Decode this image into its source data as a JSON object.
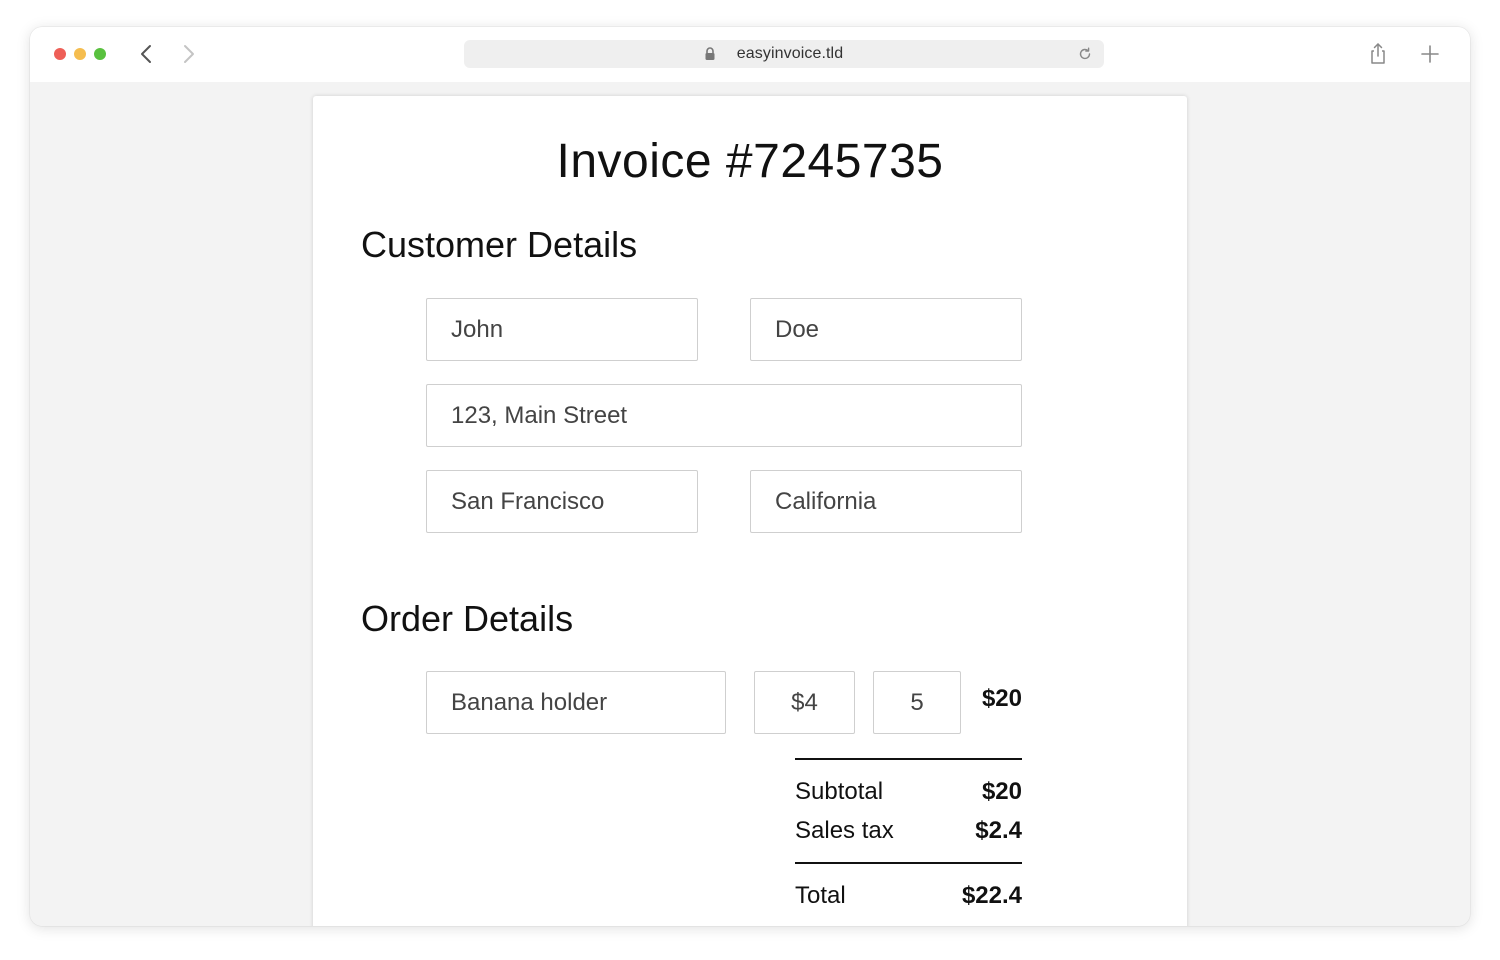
{
  "browser": {
    "url": "easyinvoice.tld"
  },
  "invoice": {
    "title": "Invoice #7245735"
  },
  "customer": {
    "heading": "Customer Details",
    "first_name": "John",
    "last_name": "Doe",
    "street": "123, Main Street",
    "city": "San Francisco",
    "state": "California"
  },
  "order": {
    "heading": "Order Details",
    "items": [
      {
        "name": "Banana holder",
        "price": "$4",
        "quantity": "5",
        "line_total": "$20"
      }
    ],
    "summary": {
      "subtotal_label": "Subtotal",
      "subtotal_value": "$20",
      "tax_label": "Sales tax",
      "tax_value": "$2.4",
      "total_label": "Total",
      "total_value": "$22.4"
    }
  }
}
